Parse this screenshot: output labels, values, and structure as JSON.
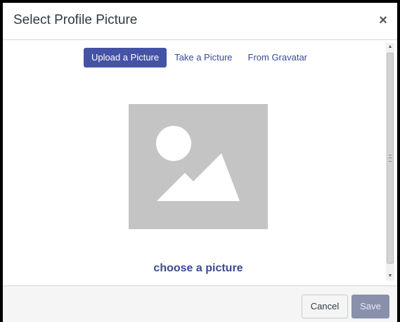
{
  "dialog": {
    "title": "Select Profile Picture",
    "close_label": "×"
  },
  "tabs": [
    {
      "label": "Upload a Picture",
      "active": true
    },
    {
      "label": "Take a Picture",
      "active": false
    },
    {
      "label": "From Gravatar",
      "active": false
    }
  ],
  "main": {
    "placeholder_icon": "image-placeholder-icon",
    "choose_link": "choose a picture"
  },
  "scrollbar": {
    "up_arrow": "▲",
    "down_arrow": "▼"
  },
  "footer": {
    "cancel_label": "Cancel",
    "save_label": "Save"
  },
  "colors": {
    "accent": "#4553a6",
    "link": "#3b4a92",
    "save_disabled": "#8990ac",
    "placeholder_bg": "#c4c4c4"
  }
}
